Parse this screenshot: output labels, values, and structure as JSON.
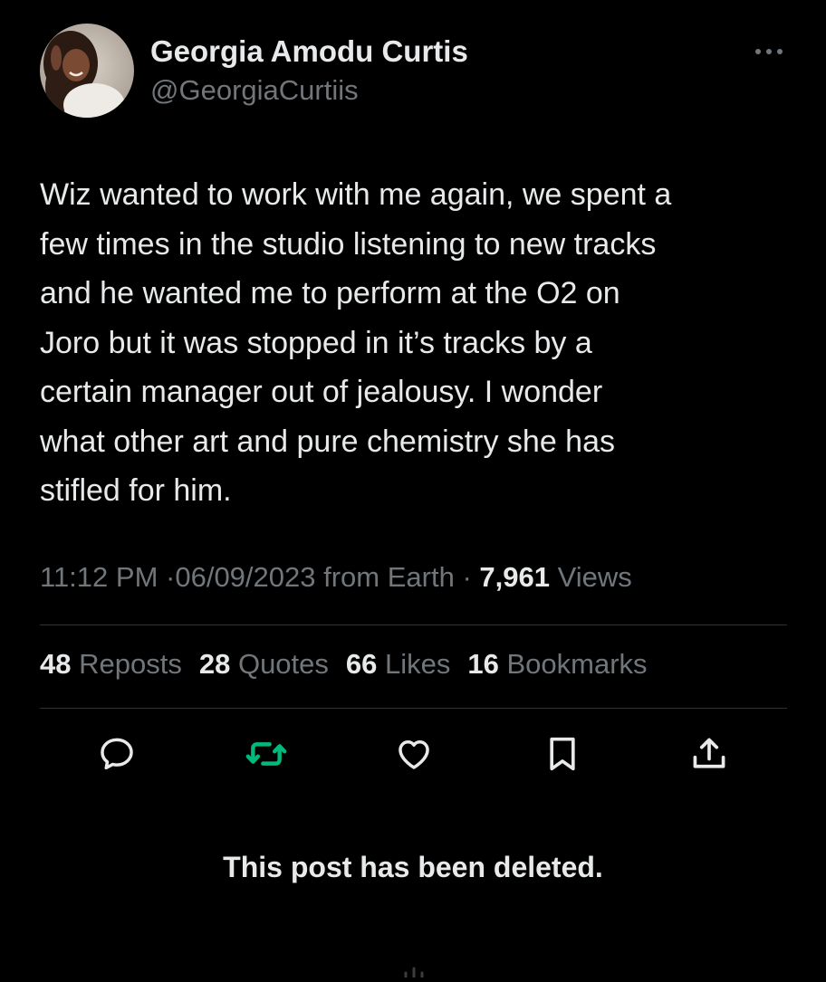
{
  "author": {
    "display_name": "Georgia Amodu Curtis",
    "handle": "@GeorgiaCurtiis"
  },
  "post": {
    "text": "Wiz wanted to work with me again, we spent a\nfew times in the studio listening to new tracks\nand he wanted me to perform at the O2 on\nJoro but it was stopped in it’s tracks by a\ncertain manager out of jealousy. I wonder\nwhat other art and pure chemistry she has\nstifled for him.",
    "time": "11:12 PM",
    "date": "06/09/2023",
    "source": "from Earth",
    "separator": "·",
    "views_count": "7,961",
    "views_label": "Views"
  },
  "stats": [
    {
      "count": "48",
      "label": "Reposts"
    },
    {
      "count": "28",
      "label": "Quotes"
    },
    {
      "count": "66",
      "label": "Likes"
    },
    {
      "count": "16",
      "label": "Bookmarks"
    }
  ],
  "actions": [
    {
      "name": "reply",
      "icon": "reply-icon"
    },
    {
      "name": "repost",
      "icon": "repost-icon",
      "color": "#00ba7c"
    },
    {
      "name": "like",
      "icon": "heart-icon"
    },
    {
      "name": "bookmark",
      "icon": "bookmark-icon"
    },
    {
      "name": "share",
      "icon": "share-icon"
    }
  ],
  "deleted_notice": "This post has been deleted.",
  "colors": {
    "background": "#000000",
    "primary_text": "#e7e9ea",
    "secondary_text": "#71767b",
    "divider": "#2f3336",
    "repost_active": "#00ba7c"
  }
}
